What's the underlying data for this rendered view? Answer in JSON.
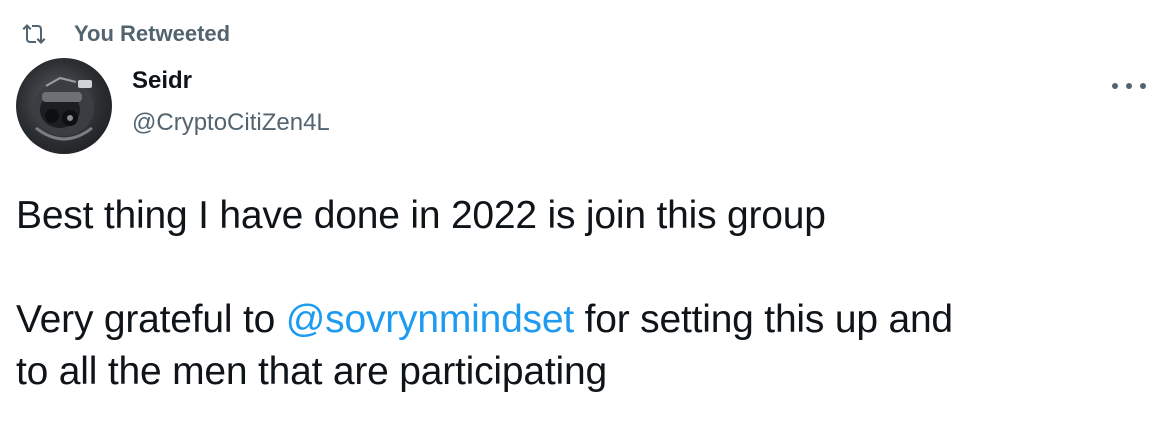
{
  "retweet_banner": {
    "icon": "retweet-icon",
    "label": "You Retweeted"
  },
  "author": {
    "display_name": "Seidr",
    "handle": "@CryptoCitiZen4L",
    "avatar": "avatar-image"
  },
  "more_menu": {
    "icon": "more-horizontal-icon"
  },
  "tweet": {
    "line1": "Best thing I have done in 2022 is join this group",
    "line2_before": "Very grateful to ",
    "mention": "@sovrynmindset",
    "line2_after": " for setting this up and",
    "line3": "to all the men that are participating"
  },
  "colors": {
    "text": "#0f1419",
    "secondary": "#536471",
    "link": "#1d9bf0"
  }
}
